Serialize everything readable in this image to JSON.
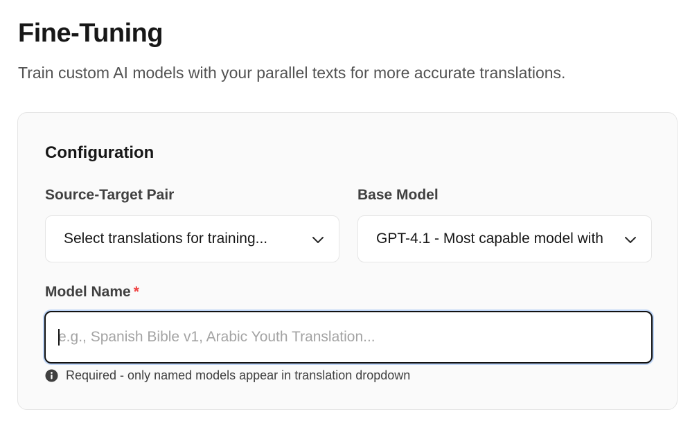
{
  "header": {
    "title": "Fine-Tuning",
    "subtitle": "Train custom AI models with your parallel texts for more accurate translations."
  },
  "configuration": {
    "title": "Configuration",
    "source_target_pair": {
      "label": "Source-Target Pair",
      "value": "Select translations for training..."
    },
    "base_model": {
      "label": "Base Model",
      "value": "GPT-4.1 - Most capable model with"
    },
    "model_name": {
      "label": "Model Name",
      "required_marker": "*",
      "placeholder": "e.g., Spanish Bible v1, Arabic Youth Translation...",
      "value": "",
      "helper_text": "Required - only named models appear in translation dropdown",
      "helper_icon": "info-icon"
    }
  },
  "colors": {
    "required": "#ef4444",
    "focus_ring": "#bcd3f5",
    "card_background": "#fafafa"
  }
}
